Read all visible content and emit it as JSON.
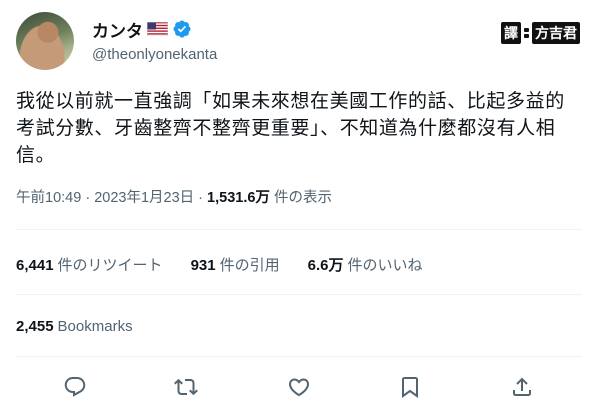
{
  "author": {
    "display_name": "カンタ",
    "handle": "@theonlyonekanta",
    "flag_icon": "us-flag-icon",
    "verified_icon": "verified-badge-icon"
  },
  "watermark": {
    "boxed_char": "譯",
    "name": "方吉君"
  },
  "tweet": {
    "lines": [
      "我從以前就一直強調「如果未來想在美國工作的話、比起多益的",
      "考試分數、牙齒整齊不整齊更重要」、不知道為什麼都沒有人相",
      "信。"
    ]
  },
  "meta": {
    "time": "午前10:49",
    "sep1": " · ",
    "date": "2023年1月23日",
    "sep2": " · ",
    "views_count": "1,531.6万",
    "views_label": " 件の表示"
  },
  "stats": {
    "retweets_count": "6,441",
    "retweets_label": "件のリツイート",
    "quotes_count": "931",
    "quotes_label": "件の引用",
    "likes_count": "6.6万",
    "likes_label": "件のいいね"
  },
  "bookmarks": {
    "count": "2,455",
    "label": "Bookmarks"
  },
  "actions": [
    "reply-icon",
    "retweet-icon",
    "like-icon",
    "bookmark-icon",
    "share-icon"
  ],
  "colors": {
    "verified": "#1d9bf0",
    "secondary_text": "#536471",
    "primary_text": "#0f1419"
  }
}
